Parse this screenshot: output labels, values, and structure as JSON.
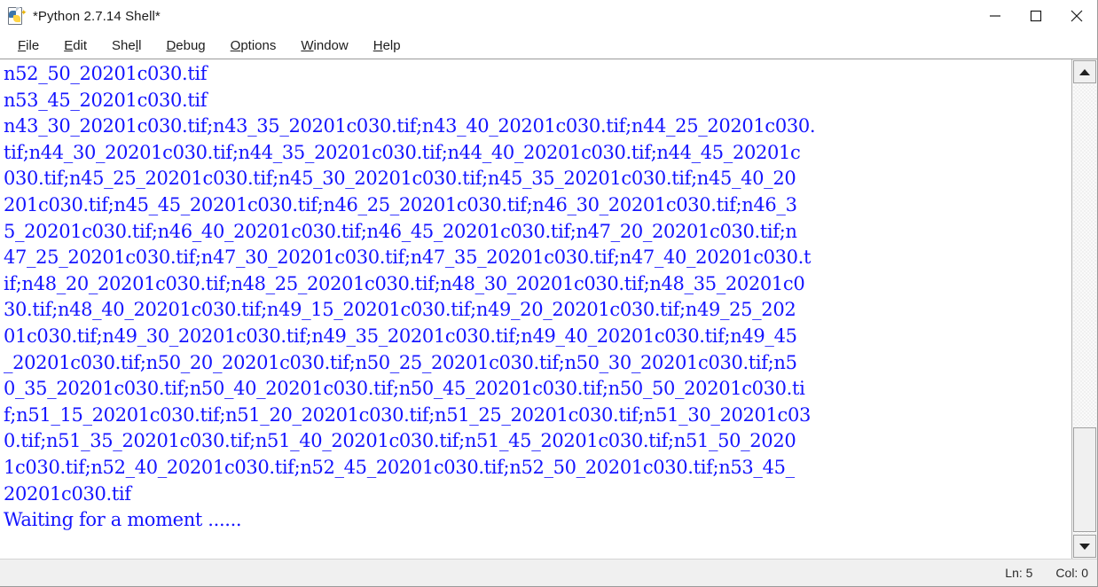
{
  "window": {
    "title": "*Python 2.7.14 Shell*",
    "icon": "python-idle-icon",
    "controls": {
      "minimize": "minimize-icon",
      "maximize": "maximize-icon",
      "close": "close-icon"
    }
  },
  "menubar": {
    "items": [
      {
        "label": "File",
        "pre": "",
        "key": "F",
        "post": "ile"
      },
      {
        "label": "Edit",
        "pre": "",
        "key": "E",
        "post": "dit"
      },
      {
        "label": "Shell",
        "pre": "She",
        "key": "l",
        "post": "l"
      },
      {
        "label": "Debug",
        "pre": "",
        "key": "D",
        "post": "ebug"
      },
      {
        "label": "Options",
        "pre": "",
        "key": "O",
        "post": "ptions"
      },
      {
        "label": "Window",
        "pre": "",
        "key": "W",
        "post": "indow"
      },
      {
        "label": "Help",
        "pre": "",
        "key": "H",
        "post": "elp"
      }
    ]
  },
  "console": {
    "text_color": "#1414ff",
    "background": "#ffffff",
    "lines": [
      "n52_50_20201c030.tif",
      "n53_45_20201c030.tif",
      "n43_30_20201c030.tif;n43_35_20201c030.tif;n43_40_20201c030.tif;n44_25_20201c030.",
      "tif;n44_30_20201c030.tif;n44_35_20201c030.tif;n44_40_20201c030.tif;n44_45_20201c",
      "030.tif;n45_25_20201c030.tif;n45_30_20201c030.tif;n45_35_20201c030.tif;n45_40_20",
      "201c030.tif;n45_45_20201c030.tif;n46_25_20201c030.tif;n46_30_20201c030.tif;n46_3",
      "5_20201c030.tif;n46_40_20201c030.tif;n46_45_20201c030.tif;n47_20_20201c030.tif;n",
      "47_25_20201c030.tif;n47_30_20201c030.tif;n47_35_20201c030.tif;n47_40_20201c030.t",
      "if;n48_20_20201c030.tif;n48_25_20201c030.tif;n48_30_20201c030.tif;n48_35_20201c0",
      "30.tif;n48_40_20201c030.tif;n49_15_20201c030.tif;n49_20_20201c030.tif;n49_25_202",
      "01c030.tif;n49_30_20201c030.tif;n49_35_20201c030.tif;n49_40_20201c030.tif;n49_45",
      "_20201c030.tif;n50_20_20201c030.tif;n50_25_20201c030.tif;n50_30_20201c030.tif;n5",
      "0_35_20201c030.tif;n50_40_20201c030.tif;n50_45_20201c030.tif;n50_50_20201c030.ti",
      "f;n51_15_20201c030.tif;n51_20_20201c030.tif;n51_25_20201c030.tif;n51_30_20201c03",
      "0.tif;n51_35_20201c030.tif;n51_40_20201c030.tif;n51_45_20201c030.tif;n51_50_2020",
      "1c030.tif;n52_40_20201c030.tif;n52_45_20201c030.tif;n52_50_20201c030.tif;n53_45_",
      "20201c030.tif",
      "Waiting for a moment ......"
    ]
  },
  "scrollbar": {
    "up_arrow": "scroll-up-arrow-icon",
    "down_arrow": "scroll-down-arrow-icon",
    "thumb": "scrollbar-thumb"
  },
  "statusbar": {
    "line_label": "Ln: 5",
    "col_label": "Col: 0"
  }
}
